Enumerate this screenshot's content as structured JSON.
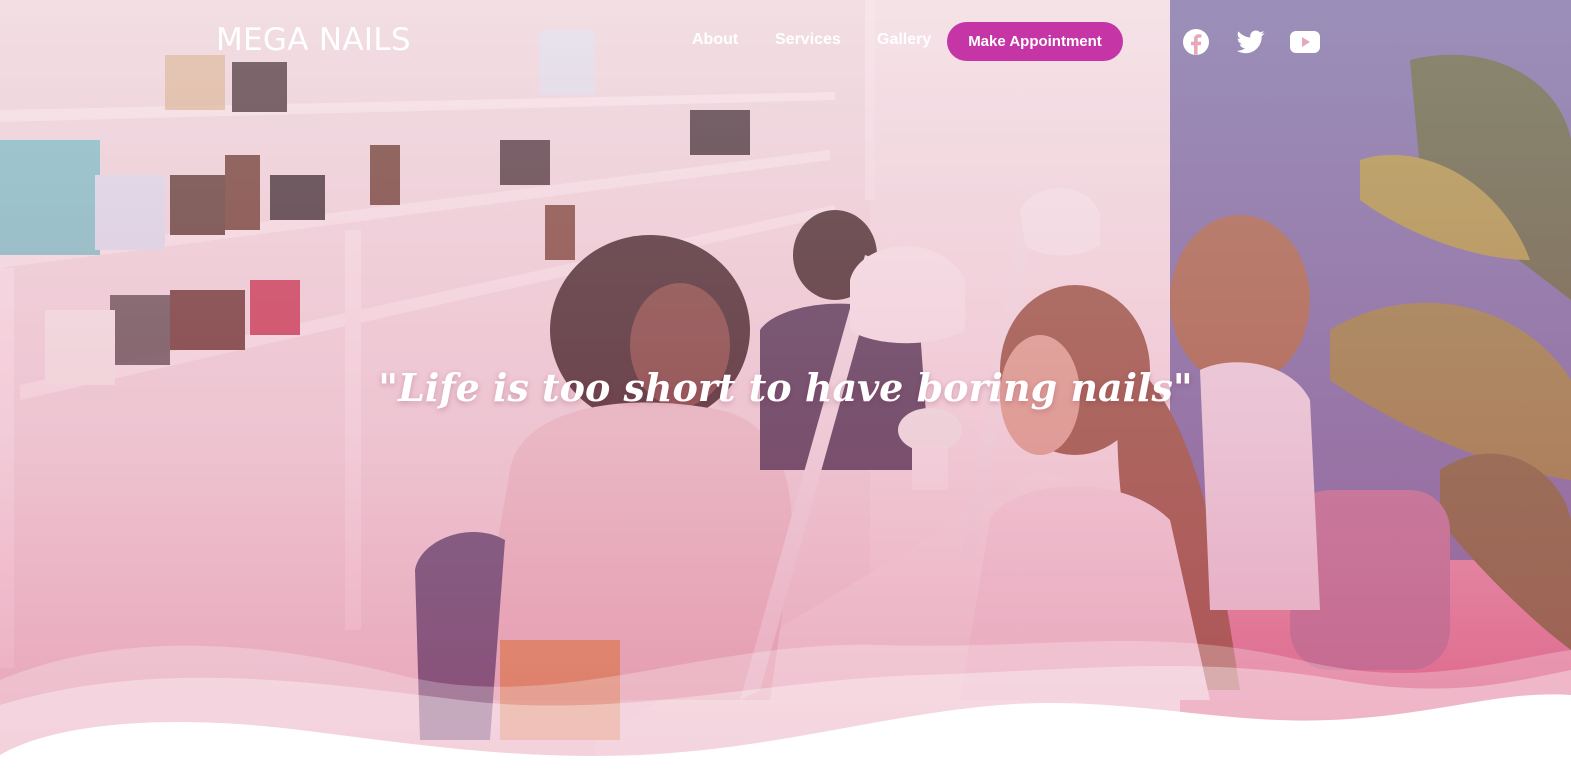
{
  "brand": {
    "name": "MEGA NAILS"
  },
  "nav": {
    "items": [
      {
        "label": "About"
      },
      {
        "label": "Services"
      },
      {
        "label": "Gallery"
      }
    ],
    "cta_label": "Make Appointment"
  },
  "social": {
    "icons": [
      "facebook-icon",
      "twitter-icon",
      "youtube-icon"
    ]
  },
  "hero": {
    "tagline": "\"Life is too short to have boring nails\""
  },
  "colors": {
    "accent": "#c535a6",
    "overlay_pink": "#e07d9b",
    "text": "#ffffff"
  }
}
